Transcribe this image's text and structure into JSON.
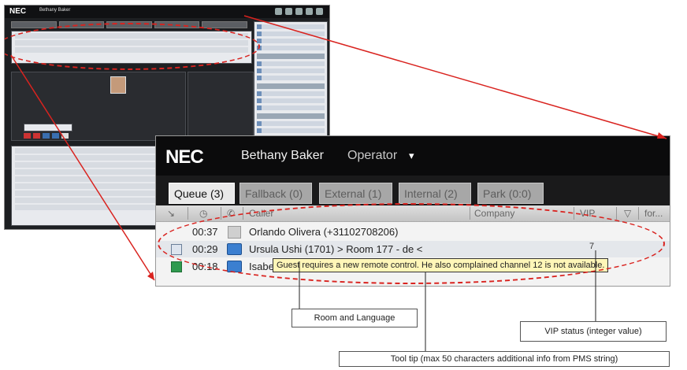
{
  "thumbnail": {
    "logo": "NEC",
    "user": "Bethany Baker"
  },
  "app": {
    "logo": "NEC",
    "user_name": "Bethany Baker",
    "role": "Operator",
    "role_caret": "▾"
  },
  "tabs": [
    {
      "label": "Queue",
      "count": "(3)"
    },
    {
      "label": "Fallback",
      "count": "(0)"
    },
    {
      "label": "External",
      "count": "(1)"
    },
    {
      "label": "Internal",
      "count": "(2)"
    },
    {
      "label": "Park",
      "count": "(0:0)"
    }
  ],
  "columns": {
    "caller": "Caller",
    "company": "Company",
    "vip": "VIP",
    "for": "for..."
  },
  "calls": [
    {
      "time": "00:37",
      "name": "Orlando Olivera (+31102708206)"
    },
    {
      "time": "00:29",
      "name": "Ursula Ushi (1701)  > Room 177 - de <"
    },
    {
      "time": "00:18",
      "name": "Isabe"
    }
  ],
  "vip_value": "7",
  "tooltip": "Guest requires a new remote control. He also complained channel 12 is not available.",
  "callouts": {
    "room_language": "Room and Language",
    "vip_status": "VIP status (integer value)",
    "tool_tip": "Tool tip (max 50 characters additional info from PMS string)"
  },
  "colors": {
    "highlight_red": "#d9231f",
    "header_black": "#0b0b0c",
    "tab_active": "#e9e9e9",
    "tab_inactive": "#a7a7a7",
    "tooltip_yellow": "#fff6b8"
  }
}
